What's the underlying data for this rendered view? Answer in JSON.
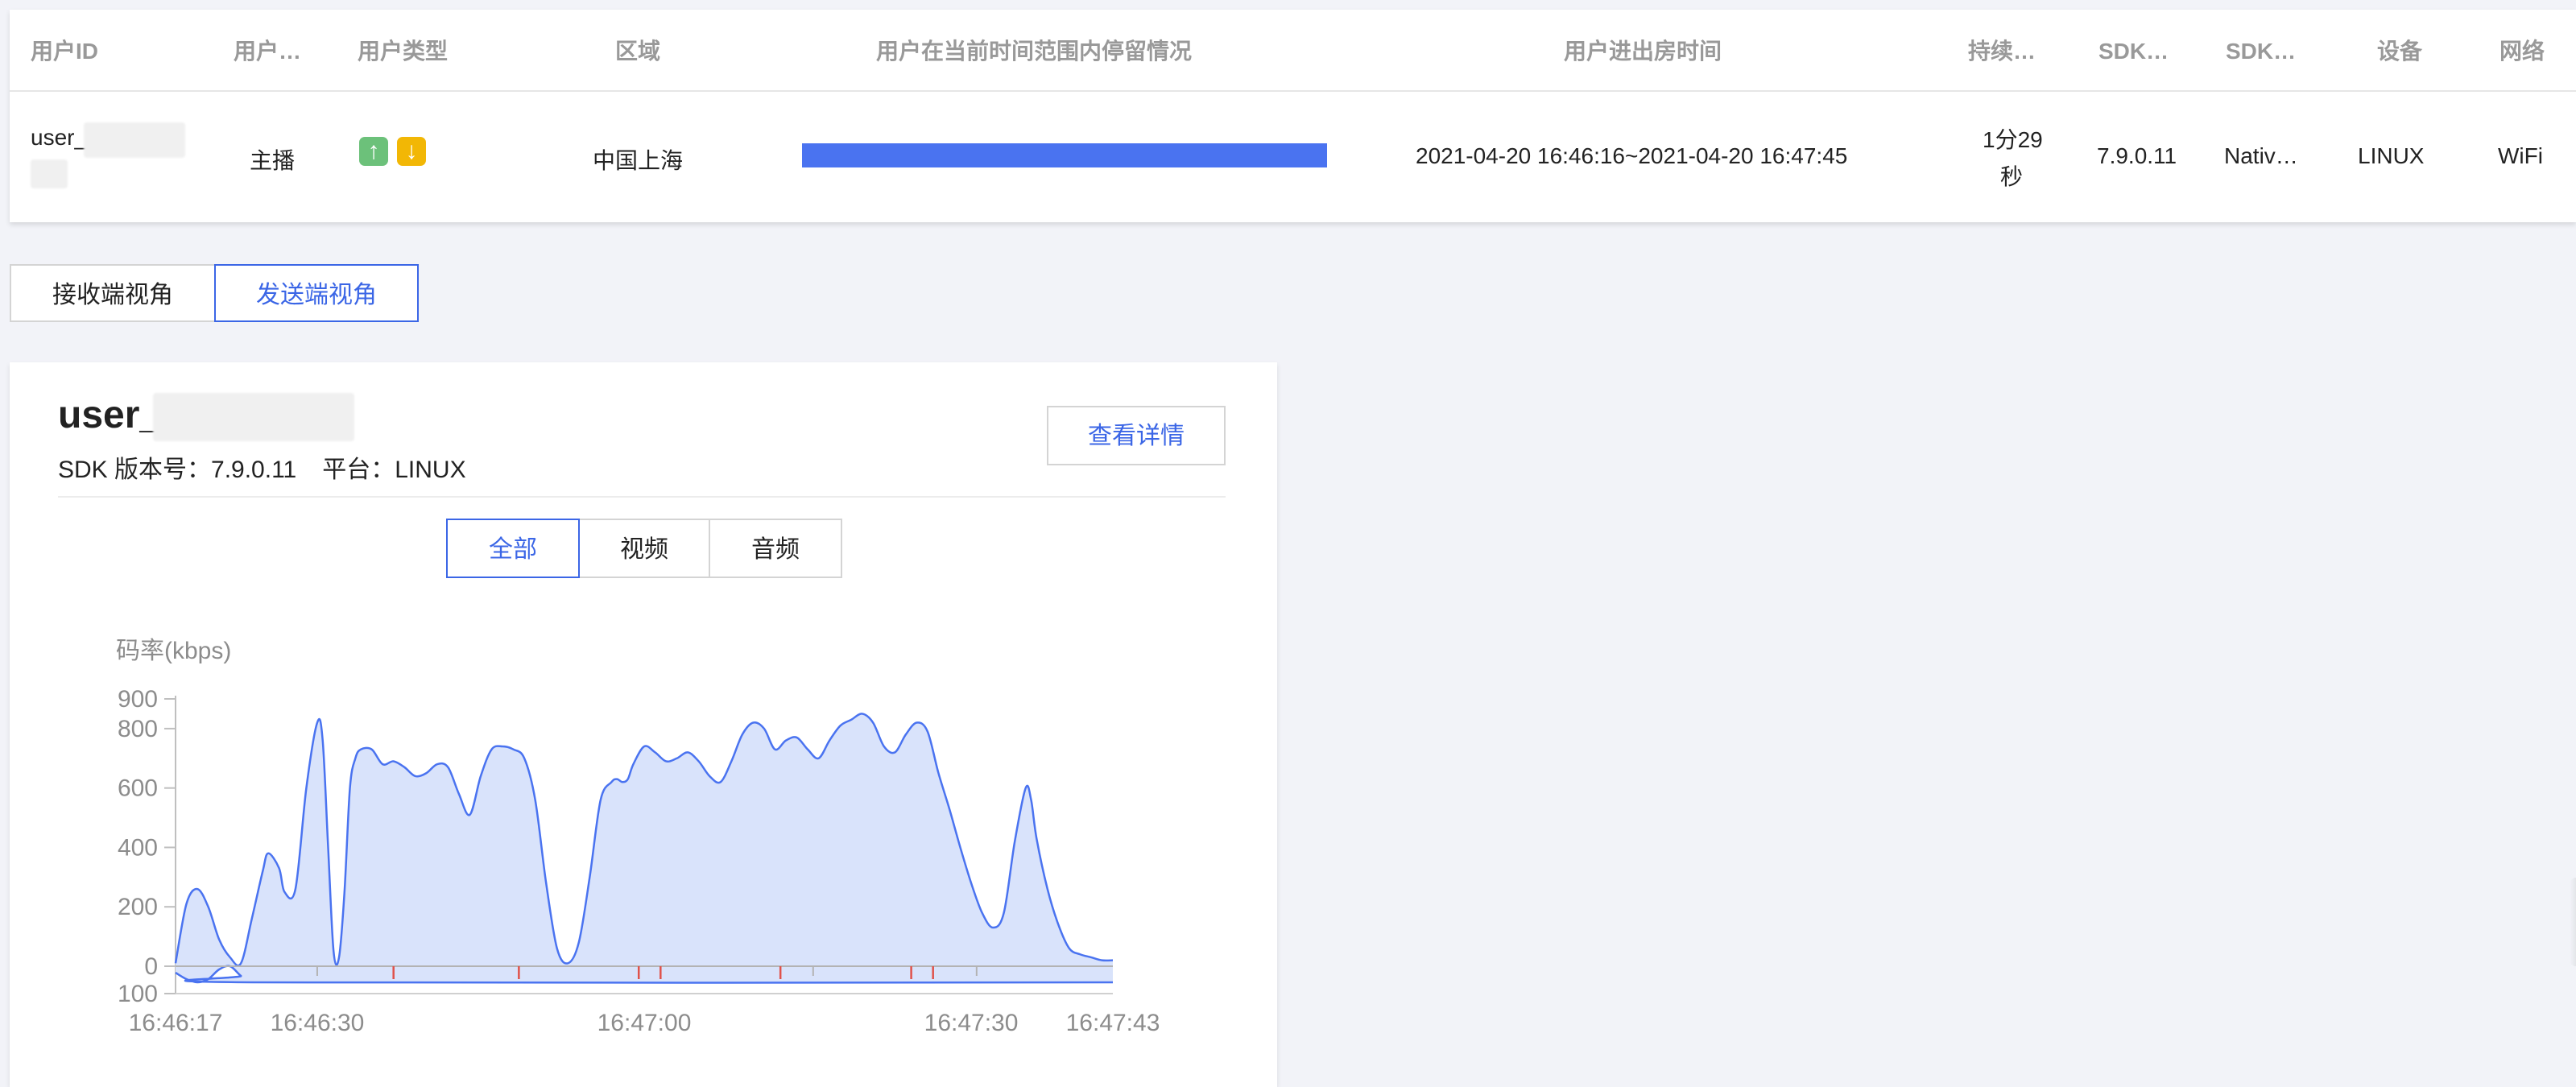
{
  "table": {
    "headers": [
      "用户ID",
      "用户…",
      "用户类型",
      "区域",
      "用户在当前时间范围内停留情况",
      "用户进出房时间",
      "持续…",
      "SDK…",
      "SDK…",
      "设备",
      "网络"
    ],
    "row": {
      "user_id": "user_",
      "role": "主播",
      "type_icons": [
        "arrow-up-icon",
        "arrow-down-icon"
      ],
      "region": "中国上海",
      "stay_fraction": 1.0,
      "time_range": "2021-04-20 16:46:16~2021-04-20 16:47:45",
      "duration_line1": "1分29",
      "duration_line2": "秒",
      "sdk_version": "7.9.0.11",
      "sdk_platform": "Nativ…",
      "device": "LINUX",
      "network": "WiFi"
    }
  },
  "view_toggle": {
    "receiver": "接收端视角",
    "sender": "发送端视角",
    "active": "sender"
  },
  "detail": {
    "user_name": "user_",
    "sdk_version_label": "SDK 版本号：7.9.0.11",
    "platform_label": "平台：LINUX",
    "detail_button": "查看详情",
    "filters": [
      "全部",
      "视频",
      "音频"
    ],
    "active_filter": "全部"
  },
  "colors": {
    "accent": "#3b66e6",
    "series_line": "#4a73f0",
    "series_fill": "#d9e3fb",
    "up_icon": "#6cc17a",
    "down_icon": "#f2b705",
    "marker": "#e0524a"
  },
  "chart_data": {
    "type": "area",
    "title": "",
    "ylabel": "码率(kbps)",
    "xlabel": "",
    "x_tick_labels": [
      "16:46:17",
      "16:46:30",
      "16:47:00",
      "16:47:30",
      "16:47:43"
    ],
    "x_tick_seconds": [
      0,
      13,
      43,
      73,
      86
    ],
    "y_tick_labels": [
      "900",
      "800",
      "600",
      "400",
      "200",
      "0",
      "100"
    ],
    "y_tick_values": [
      900,
      800,
      600,
      400,
      200,
      0,
      -100
    ],
    "ylim": [
      -100,
      900
    ],
    "xlim_seconds": [
      0,
      86
    ],
    "series": [
      {
        "seconds": [
          0,
          1,
          2,
          3,
          4,
          5,
          6,
          7,
          8,
          8.5,
          9.5,
          10,
          11,
          12,
          13,
          13.5,
          14,
          14.5,
          15,
          15.5,
          16,
          16.5,
          17,
          18,
          19,
          20,
          21,
          22,
          23,
          24,
          25,
          26,
          27,
          28,
          29,
          30,
          31,
          32,
          33,
          34,
          35,
          36,
          37,
          38,
          39,
          40,
          40.5,
          41,
          41.5,
          42,
          43,
          44,
          45,
          46,
          47,
          48,
          49,
          50,
          51,
          52,
          53,
          54,
          55,
          56,
          57,
          58,
          59,
          60,
          61,
          62,
          63,
          64,
          65,
          66,
          67,
          68,
          69,
          70,
          71,
          72,
          73,
          74,
          75,
          76,
          77,
          78,
          78.5,
          79,
          80,
          81,
          82,
          83,
          84,
          85,
          86
        ],
        "values": [
          10,
          210,
          260,
          200,
          90,
          30,
          10,
          160,
          320,
          380,
          330,
          250,
          260,
          600,
          820,
          760,
          400,
          50,
          30,
          250,
          600,
          700,
          730,
          730,
          680,
          690,
          670,
          640,
          650,
          680,
          670,
          580,
          510,
          640,
          730,
          740,
          730,
          700,
          560,
          280,
          60,
          10,
          80,
          300,
          560,
          620,
          630,
          620,
          630,
          680,
          740,
          720,
          690,
          700,
          720,
          690,
          640,
          620,
          690,
          780,
          820,
          800,
          730,
          760,
          770,
          730,
          700,
          760,
          810,
          830,
          850,
          820,
          740,
          720,
          780,
          820,
          790,
          650,
          530,
          400,
          280,
          180,
          130,
          180,
          420,
          600,
          560,
          430,
          260,
          140,
          60,
          40,
          30,
          20,
          20
        ]
      },
      {
        "seconds": [
          0,
          1,
          2,
          3,
          4,
          5,
          6,
          7,
          86
        ],
        "values": [
          -20,
          -40,
          -50,
          -40,
          -10,
          0,
          -30,
          -50,
          -50
        ]
      }
    ],
    "event_markers_seconds": [
      20,
      31.5,
      42.5,
      44.5,
      55.5,
      67.5,
      69.5
    ],
    "grid": false,
    "legend": "none"
  }
}
